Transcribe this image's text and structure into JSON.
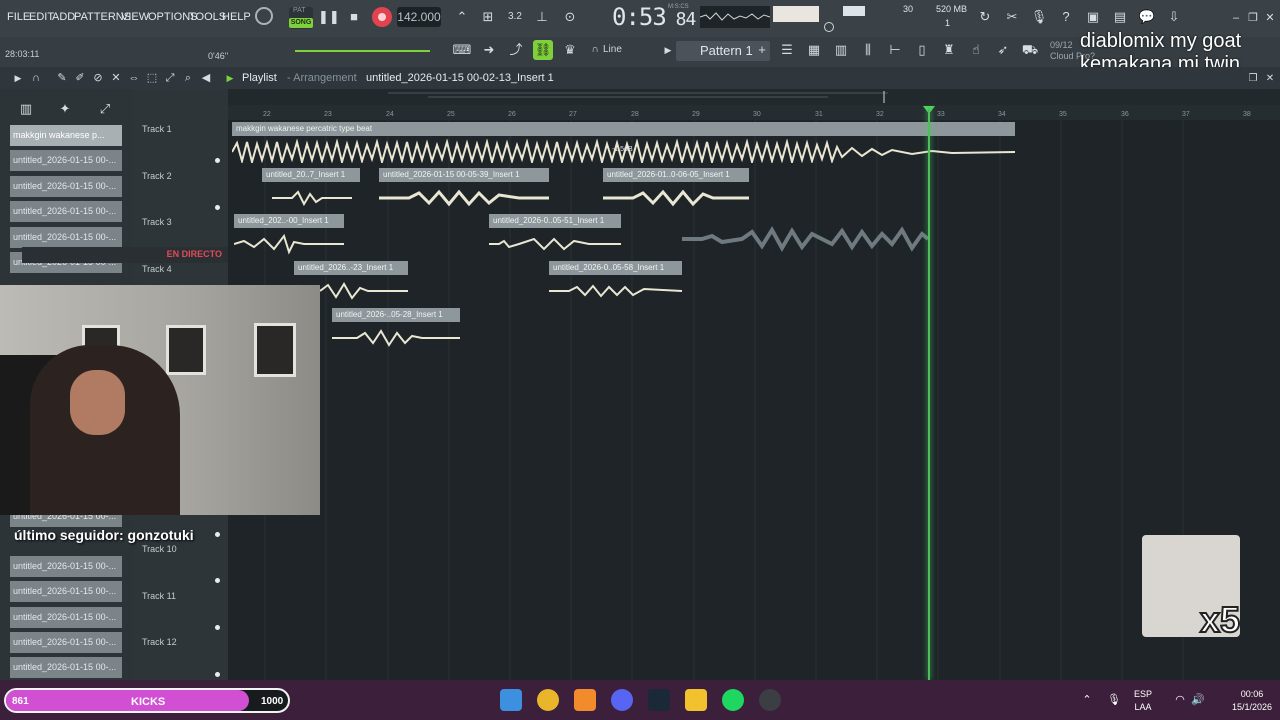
{
  "menu": [
    "FILE",
    "EDIT",
    "ADD",
    "PATTERNS",
    "VIEW",
    "OPTIONS",
    "TOOLS",
    "HELP"
  ],
  "transport": {
    "pat": "PAT",
    "song": "SONG",
    "tempo": "142.000",
    "time_main": "0:53",
    "time_sub": "84",
    "mscs": "M:S:CS"
  },
  "meters": {
    "cpu": "30",
    "memory": "520 MB",
    "memory_sub": "1"
  },
  "hint": {
    "time_strip": "28:03:11",
    "bar_time": "0'46''",
    "line": "Line",
    "pattern": "Pattern 1",
    "cloud_date": "09/12",
    "cloud_pro": "Cloud Pro?"
  },
  "overlay_text": {
    "line1": "diablomix my goat",
    "line2": "kemakana mi twin"
  },
  "playlist": {
    "title": "Playlist",
    "subtitle": "- Arrangement",
    "name": "untitled_2026-01-15 00-02-13_Insert 1"
  },
  "browser_items": [
    "makkgin wakanese p...",
    "untitled_2026-01-15 00-...",
    "untitled_2026-01-15 00-...",
    "untitled_2026-01-15 00-...",
    "untitled_2026-01-15 00-...",
    "untitled_2026-01-15 00-...",
    "untitled_2026-01-15 00-...",
    "untitled_2026-01-15 00-...",
    "untitled_2026-01-15 00-...",
    "untitled_2026-01-15 00-...",
    "untitled_2026-01-15 00-...",
    "untitled_2026-01-15 00-...",
    "untitled_2026-01-15 00-..."
  ],
  "tracks": [
    "Track 1",
    "Track 2",
    "Track 3",
    "Track 4",
    "Track 10",
    "Track 11",
    "Track 12"
  ],
  "ruler_numbers": [
    "22",
    "23",
    "24",
    "25",
    "26",
    "27",
    "28",
    "29",
    "30",
    "31",
    "32",
    "33",
    "34",
    "35",
    "36",
    "37",
    "38"
  ],
  "clips": {
    "t1": "makkgin wakanese percatric type beat",
    "t2a": "untitled_20..7_Insert 1",
    "t2b": "untitled_2026-01-15 00-05-39_Insert 1",
    "t2c": "untitled_2026-01..0-06-05_Insert 1",
    "t3a": "untitled_202..-00_Insert 1",
    "t3b": "untitled_2026-0..05-51_Insert 1",
    "t4a": "untitled_2026..-23_Insert 1",
    "t4b": "untitled_2026-0..05-58_Insert 1",
    "t5a": "untitled_2026-..05-28_Insert 1",
    "db": "-1.5dB"
  },
  "stream": {
    "follower": "último seguidor: gonzotuki",
    "live": "EN DIRECTO",
    "emote_mult": "x5"
  },
  "kicks": {
    "min": "861",
    "label": "KICKS",
    "max": "1000",
    "progress_fraction": 0.86
  },
  "taskbar": {
    "lang": "ESP",
    "lang2": "LAA",
    "time": "00:06",
    "date": "15/1/2026"
  },
  "colors": {
    "accent_green": "#7fd13b",
    "record": "#e1444f",
    "playhead": "#4fbf5e",
    "kick_fill": "#d04fd3",
    "taskbar": "#3c1f3a"
  }
}
